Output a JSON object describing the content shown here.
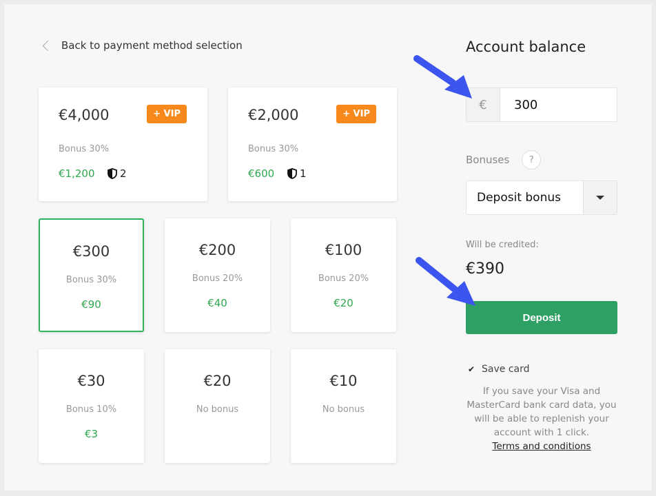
{
  "back": {
    "label": "Back to payment method selection"
  },
  "vip_cards": [
    {
      "amount": "€4,000",
      "badge": "+ VIP",
      "bonus": "Bonus 30%",
      "credit": "€1,200",
      "shield_count": "2"
    },
    {
      "amount": "€2,000",
      "badge": "+ VIP",
      "bonus": "Bonus 30%",
      "credit": "€600",
      "shield_count": "1"
    }
  ],
  "cards": [
    {
      "amount": "€300",
      "bonus": "Bonus 30%",
      "credit": "€90",
      "selected": true
    },
    {
      "amount": "€200",
      "bonus": "Bonus 20%",
      "credit": "€40"
    },
    {
      "amount": "€100",
      "bonus": "Bonus 20%",
      "credit": "€20"
    },
    {
      "amount": "€30",
      "bonus": "Bonus 10%",
      "credit": "€3"
    },
    {
      "amount": "€20",
      "bonus": "No bonus",
      "credit": ""
    },
    {
      "amount": "€10",
      "bonus": "No bonus",
      "credit": ""
    }
  ],
  "side": {
    "title": "Account balance",
    "currency": "€",
    "amount": "300",
    "bonuses_label": "Bonuses",
    "help": "?",
    "bonus_select": "Deposit bonus",
    "credited_label": "Will be credited:",
    "credited": "€390",
    "deposit": "Deposit",
    "save_card": "Save card",
    "info": "If you save your Visa and MasterCard bank card data, you will be able to replenish your account with 1 click.",
    "terms": "Terms and conditions"
  },
  "colors": {
    "accent_green": "#2fa064",
    "vip_orange": "#f7891c",
    "arrow_blue": "#3d55ef"
  }
}
